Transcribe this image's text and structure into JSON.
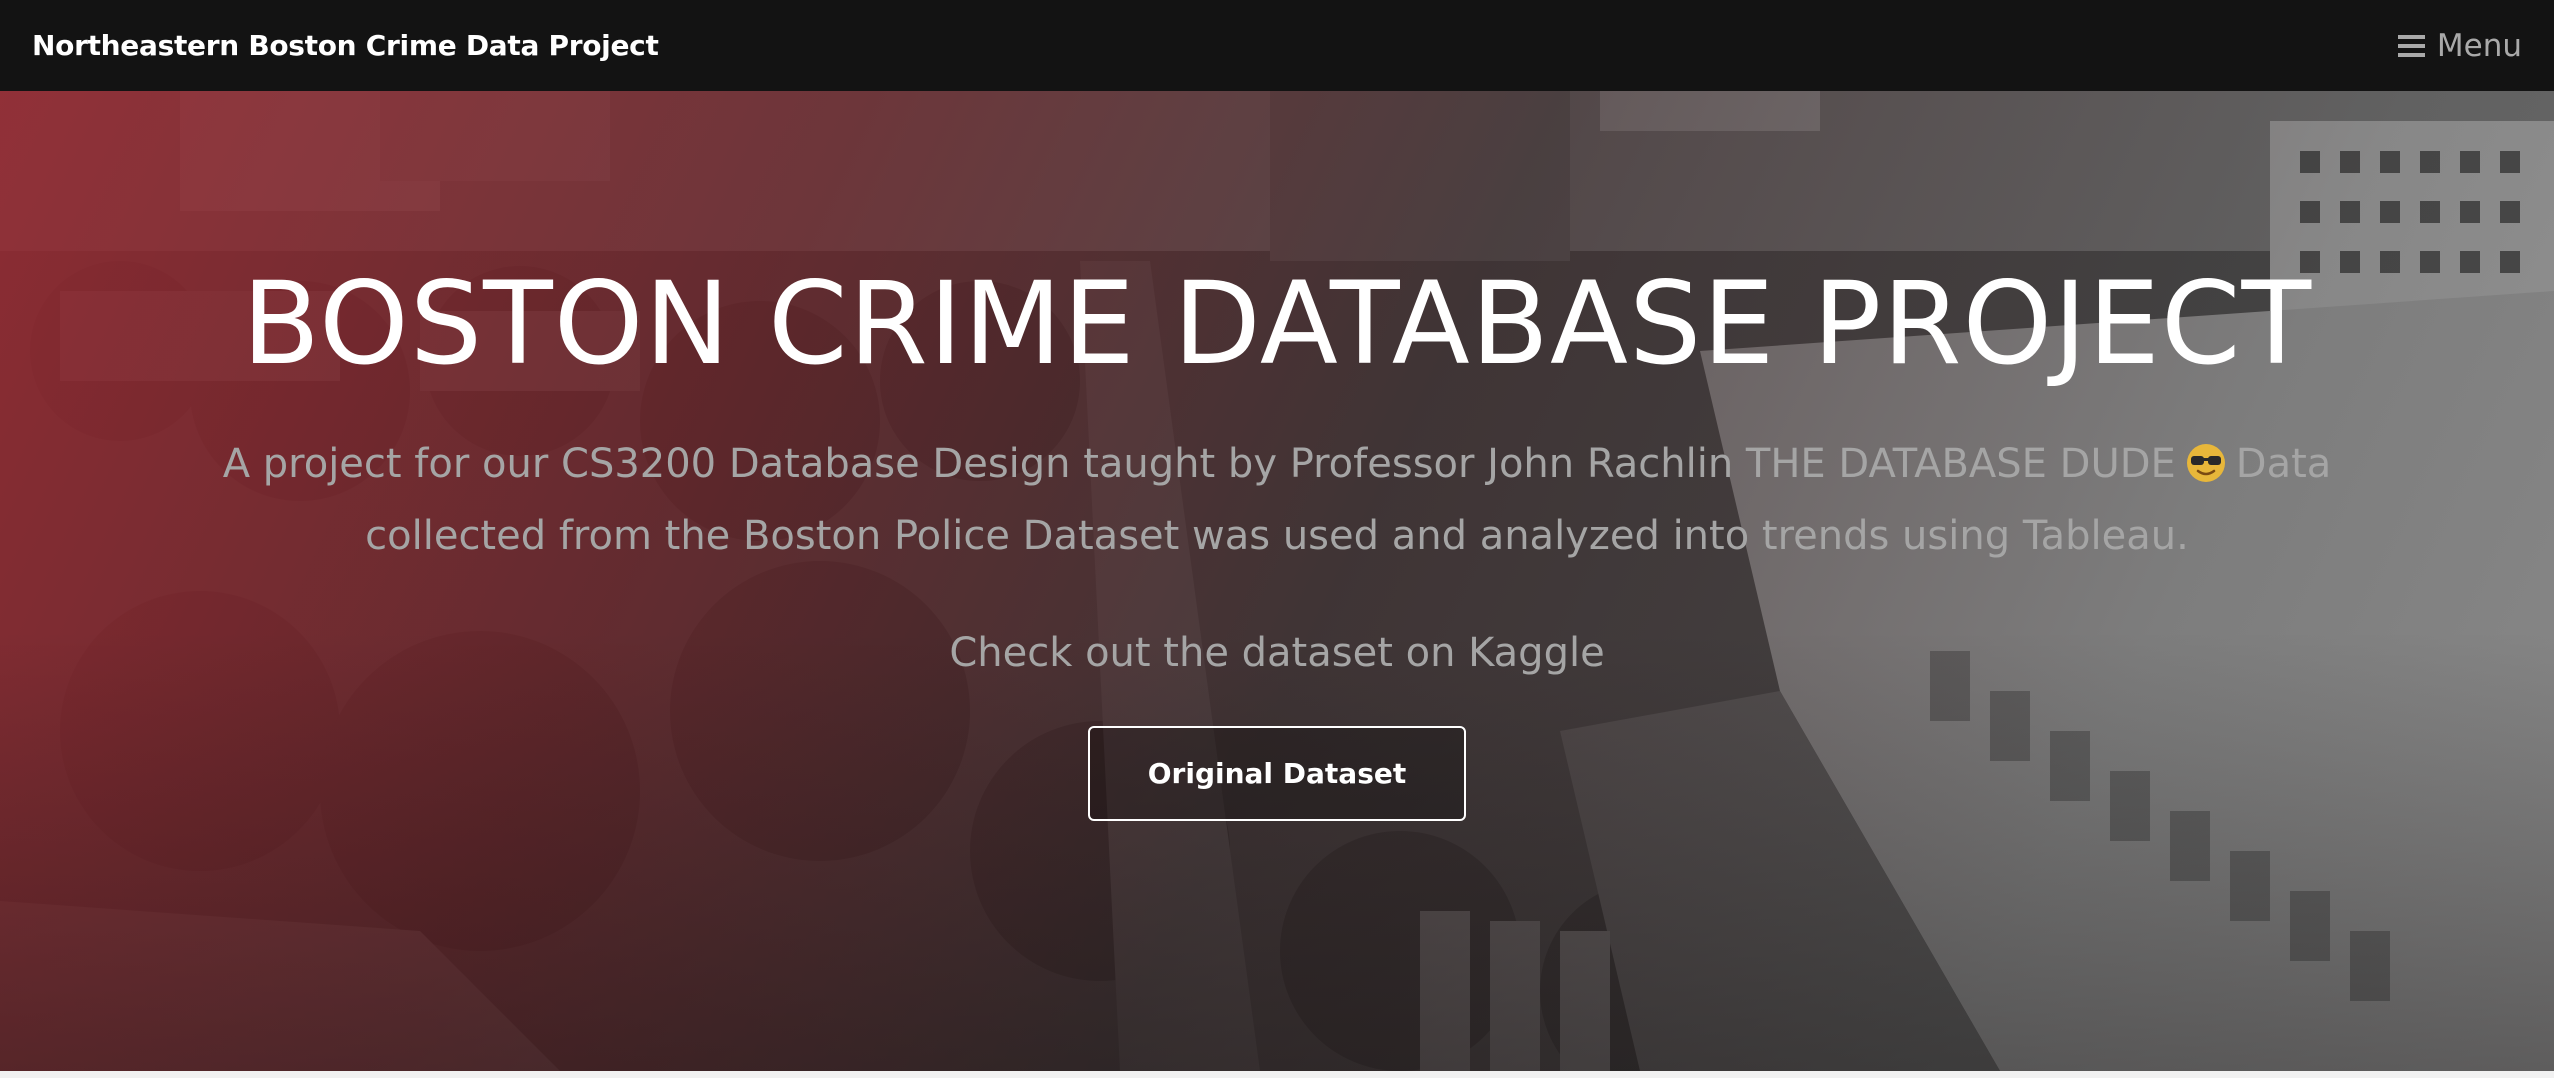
{
  "navbar": {
    "brand": "Northeastern Boston Crime Data Project",
    "menu_label": "Menu",
    "menu_icon": "hamburger-icon"
  },
  "hero": {
    "title": "BOSTON CRIME DATABASE PROJECT",
    "description_part1": "A project for our CS3200 Database Design taught by Professor John Rachlin THE DATABASE DUDE",
    "emoji_icon": "sunglasses-emoji-icon",
    "description_part2": "Data collected from the Boston Police Dataset was used and analyzed into trends using Tableau.",
    "dataset_text": "Check out the dataset on Kaggle",
    "button_label": "Original Dataset"
  },
  "colors": {
    "navbar_bg": "#131313",
    "overlay_red": "#96282f",
    "text_muted": "#a5a5a5",
    "text_white": "#ffffff"
  }
}
